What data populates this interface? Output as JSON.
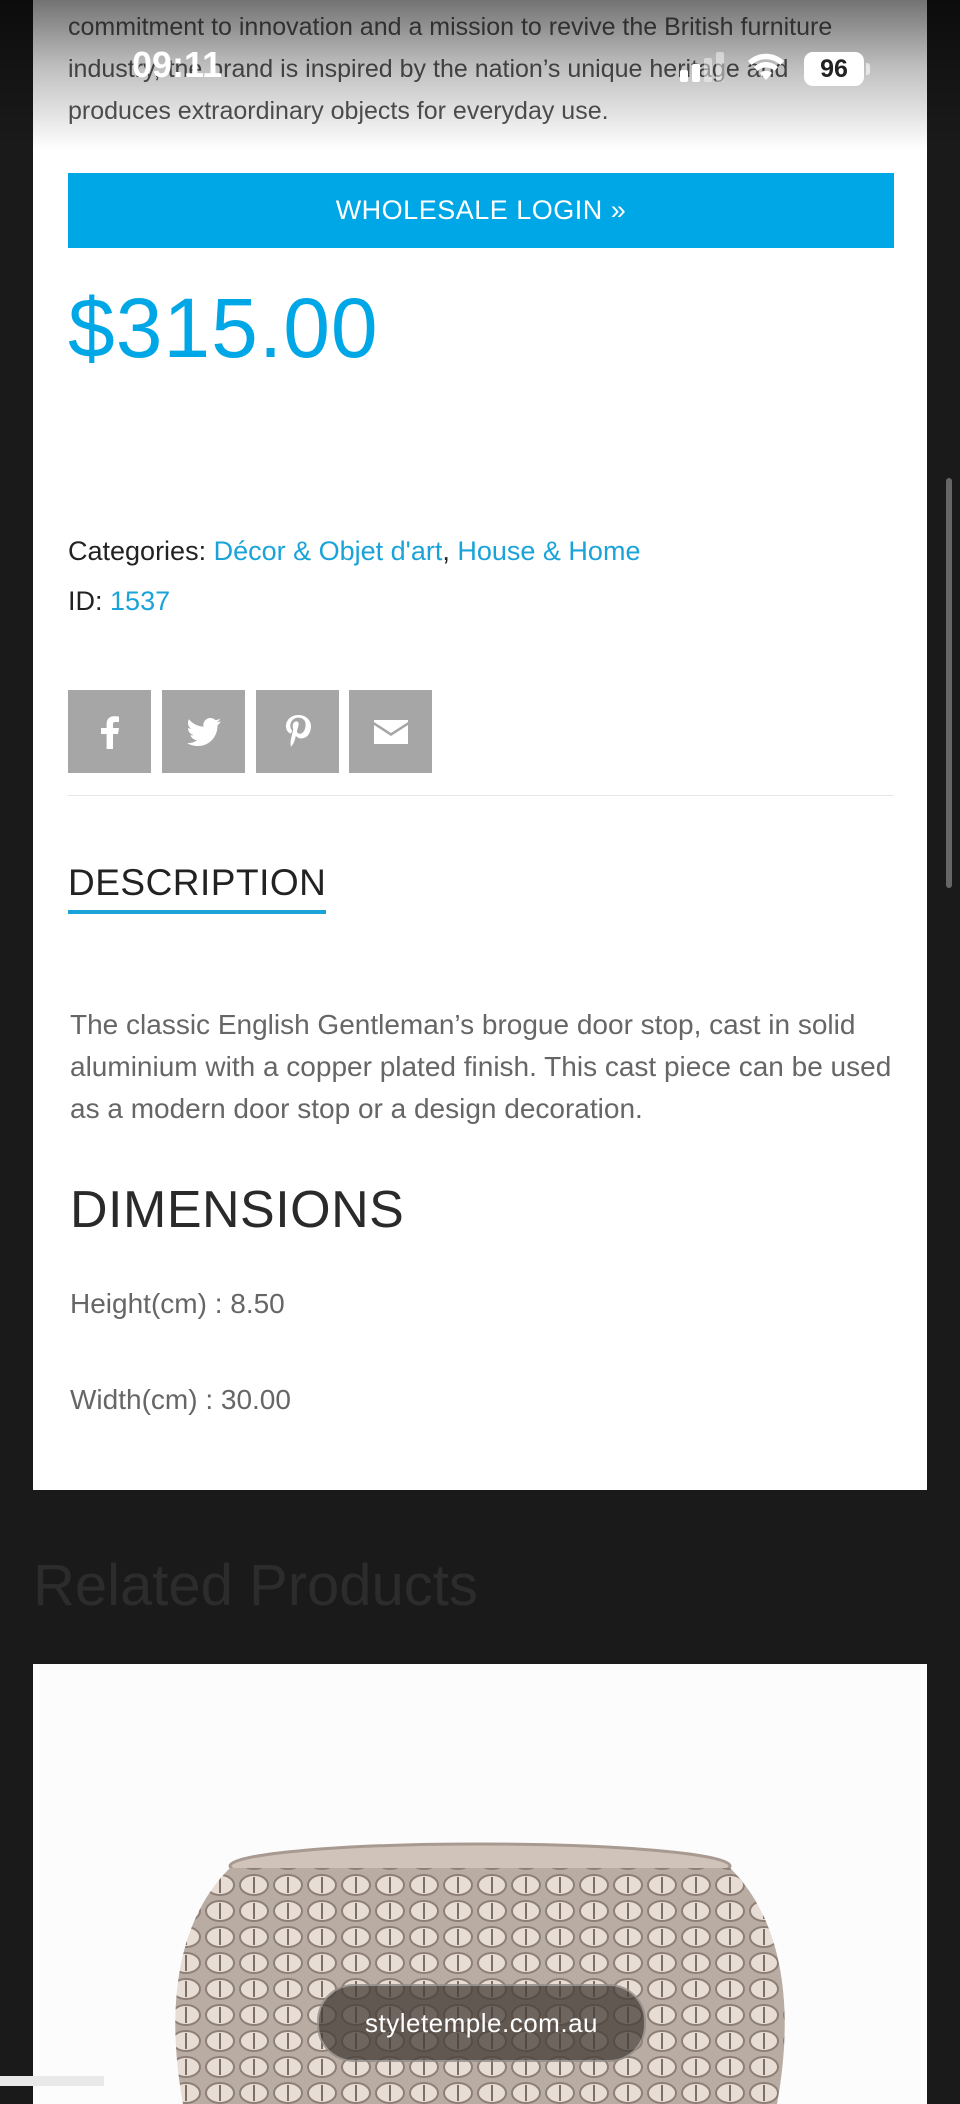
{
  "status_bar": {
    "time": "09:11",
    "battery": "96"
  },
  "intro_text": "commitment to innovation and a mission to revive the British furniture industry, the brand is inspired by the nation’s unique heritage and produces extraordinary objects for everyday use.",
  "wholesale_button": "WHOLESALE LOGIN »",
  "price": "$315.00",
  "meta": {
    "categories_label": "Categories:",
    "category_1": "Décor & Objet d'art",
    "separator": ",",
    "category_2": "House & Home",
    "id_label": "ID:",
    "id_value": "1537"
  },
  "share_icons": [
    "facebook-icon",
    "twitter-icon",
    "pinterest-icon",
    "email-icon"
  ],
  "description_tab": "DESCRIPTION",
  "description_text": "The classic English Gentleman’s brogue door stop, cast in solid aluminium with a copper plated finish. This cast piece can be used as a modern door stop or a design decoration.",
  "dimensions": {
    "title": "DIMENSIONS",
    "height": "Height(cm) : 8.50",
    "width": "Width(cm) : 30.00"
  },
  "related_title": "Related Products",
  "url_pill": "styletemple.com.au",
  "colors": {
    "accent": "#00a7e6",
    "share_bg": "#a6a6a6",
    "page_bg": "#1a1a1a"
  }
}
